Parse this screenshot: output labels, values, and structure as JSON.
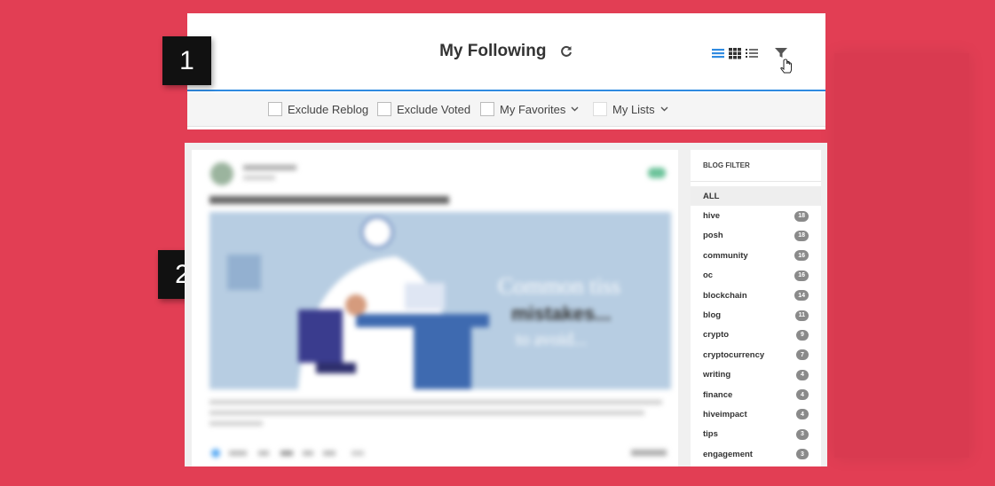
{
  "header": {
    "title": "My Following",
    "icons": [
      "refresh-icon",
      "list-view-icon",
      "grid-view-icon",
      "compact-list-icon",
      "filter-icon"
    ]
  },
  "filters": {
    "exclude_reblog": "Exclude Reblog",
    "exclude_voted": "Exclude Voted",
    "my_favorites": "My Favorites",
    "my_lists": "My Lists"
  },
  "callouts": {
    "one": "1",
    "two": "2"
  },
  "sidebar": {
    "title": "BLOG FILTER",
    "items": [
      {
        "label": "ALL",
        "count": ""
      },
      {
        "label": "hive",
        "count": "18"
      },
      {
        "label": "posh",
        "count": "18"
      },
      {
        "label": "community",
        "count": "16"
      },
      {
        "label": "oc",
        "count": "16"
      },
      {
        "label": "blockchain",
        "count": "14"
      },
      {
        "label": "blog",
        "count": "11"
      },
      {
        "label": "crypto",
        "count": "9"
      },
      {
        "label": "cryptocurrency",
        "count": "7"
      },
      {
        "label": "writing",
        "count": "4"
      },
      {
        "label": "finance",
        "count": "4"
      },
      {
        "label": "hiveimpact",
        "count": "4"
      },
      {
        "label": "tips",
        "count": "3"
      },
      {
        "label": "engagement",
        "count": "3"
      }
    ]
  },
  "post": {
    "image_text": [
      "Common tiss",
      "mistakes...",
      "to avoid..."
    ]
  },
  "colors": {
    "background": "#e23e54",
    "accent": "#2f8ae0",
    "badge": "#8a8a8a"
  }
}
